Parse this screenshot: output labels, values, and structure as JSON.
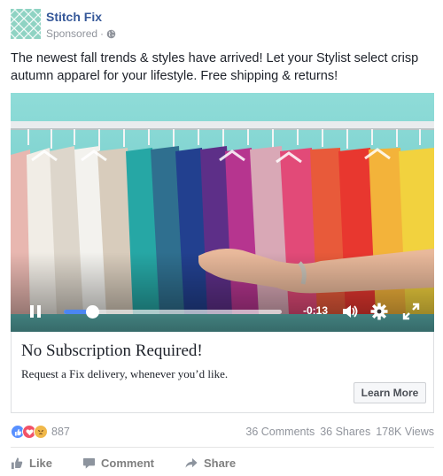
{
  "post": {
    "page_name": "Stitch Fix",
    "sponsored_label": "Sponsored",
    "meta_separator": "·",
    "text": "The newest fall trends & styles have arrived! Let your Stylist select crisp autumn apparel for your lifestyle. Free shipping & returns!"
  },
  "video": {
    "time_remaining": "-0:13",
    "progress": 0.13
  },
  "cta": {
    "title": "No Subscription Required!",
    "description": "Request a Fix delivery, whenever you’d like.",
    "button_label": "Learn More"
  },
  "stats": {
    "reaction_count": "887",
    "comments": "36 Comments",
    "shares": "36 Shares",
    "views": "178K Views"
  },
  "actions": {
    "like": "Like",
    "comment": "Comment",
    "share": "Share"
  },
  "colors": {
    "page_name": "#365899",
    "progress": "#4b86f2",
    "like_reaction": "#5890ff",
    "love_reaction": "#f25268",
    "angry_reaction": "#f0b84a"
  },
  "icons": {
    "avatar": "stitch-fix-logo",
    "audience": "globe-icon",
    "play_pause": "pause-icon",
    "volume": "volume-icon",
    "settings": "gear-icon",
    "fullscreen": "fullscreen-icon",
    "reactions": [
      "like-reaction-icon",
      "love-reaction-icon",
      "angry-reaction-icon"
    ],
    "like": "thumbs-up-icon",
    "comment": "comment-icon",
    "share": "share-arrow-icon"
  }
}
